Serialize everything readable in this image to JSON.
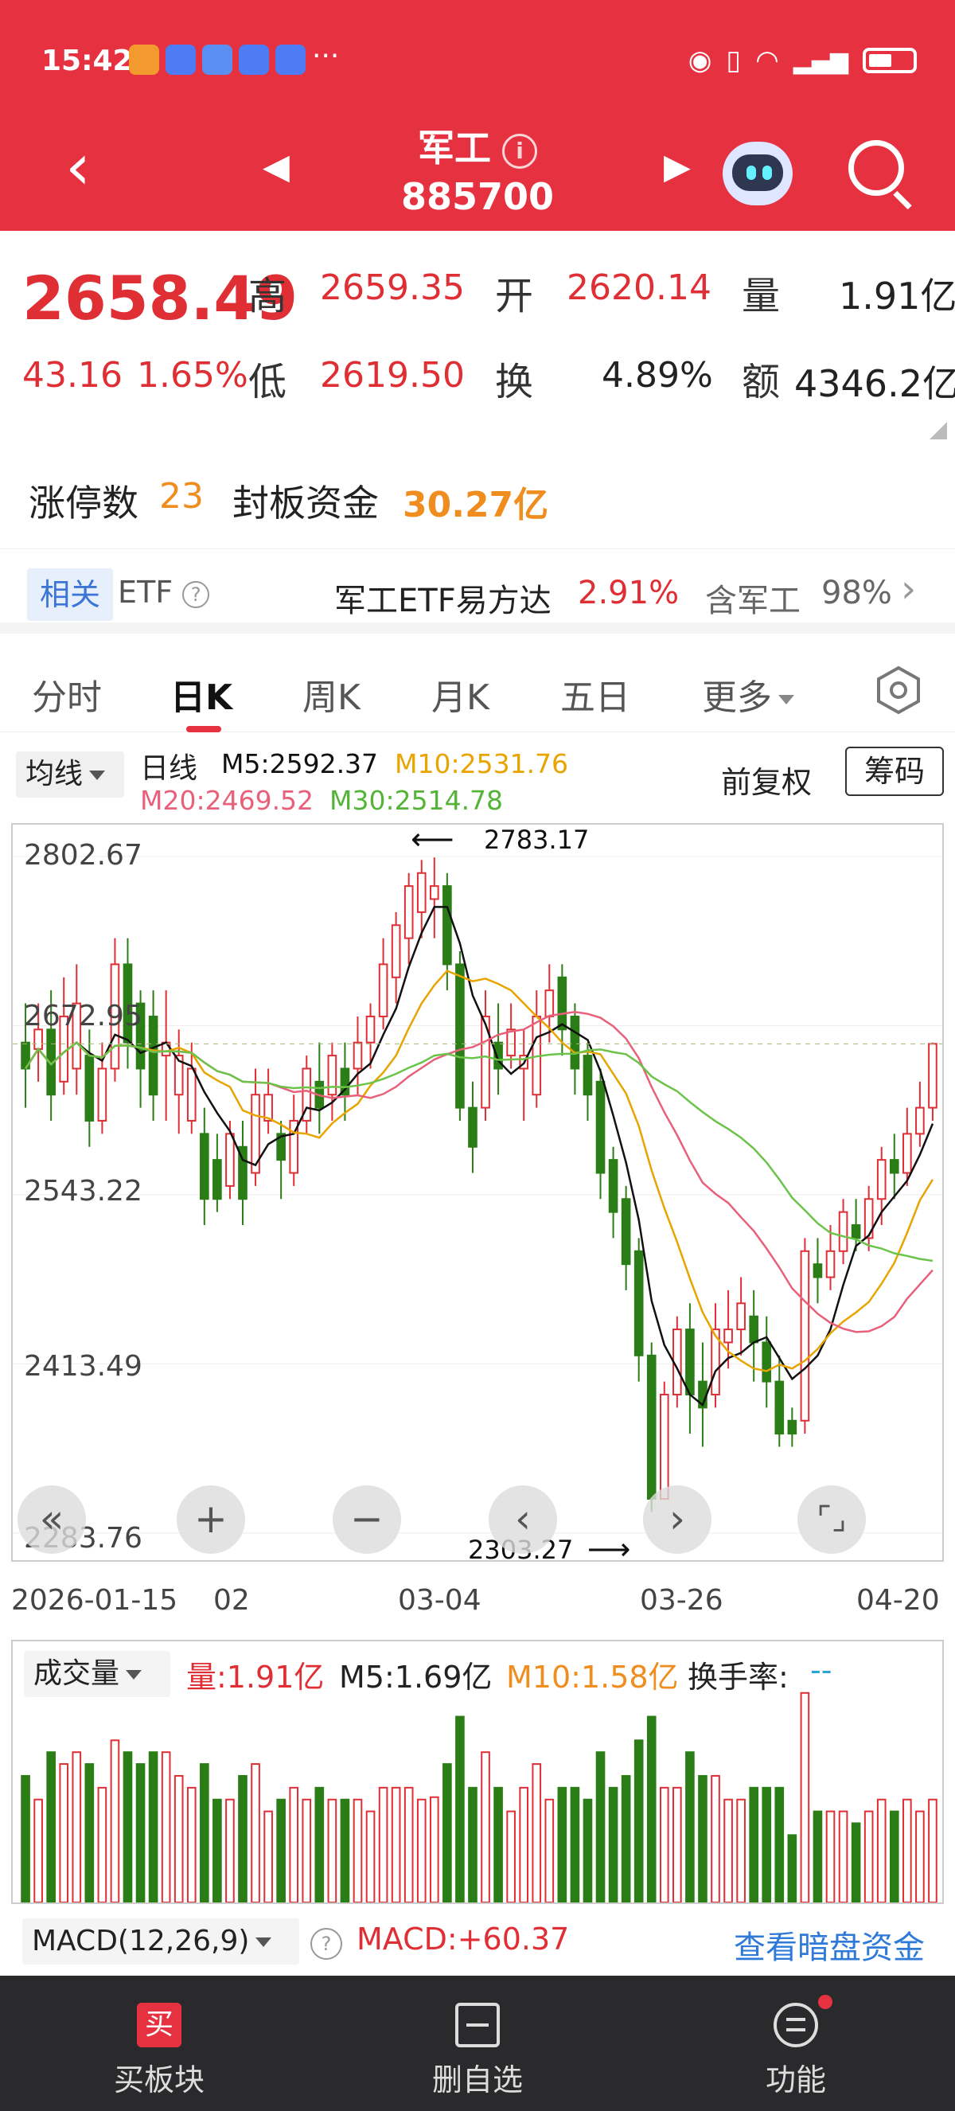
{
  "status": {
    "time": "15:42",
    "dots": "···"
  },
  "title": {
    "name": "军工",
    "info": "i",
    "code": "885700"
  },
  "quote": {
    "price": "2658.49",
    "change": "43.16",
    "change_pct": "1.65%",
    "high_label": "高",
    "high": "2659.35",
    "open_label": "开",
    "open": "2620.14",
    "vol_label": "量",
    "volume": "1.91亿",
    "low_label": "低",
    "low": "2619.50",
    "turn_label": "换",
    "turnover": "4.89%",
    "amt_label": "额",
    "amount": "4346.2亿"
  },
  "limit": {
    "count_label": "涨停数",
    "count": "23",
    "fund_label": "封板资金",
    "fund": "30.27亿"
  },
  "etf": {
    "tag": "相关",
    "label": "ETF",
    "name": "军工ETF易方达",
    "pct": "2.91%",
    "contain": "含军工",
    "contain_pct": "98%"
  },
  "tabs": [
    "分时",
    "日K",
    "周K",
    "月K",
    "五日",
    "更多"
  ],
  "legend": {
    "select": "均线",
    "type": "日线",
    "m5": "M5:2592.37",
    "m10": "M10:2531.76",
    "m20": "M20:2469.52",
    "m30": "M30:2514.78",
    "fq": "前复权",
    "chip": "筹码",
    "colors": {
      "m5": "#111111",
      "m10": "#e8a400",
      "m20": "#e8607a",
      "m30": "#6cc34a",
      "up": "#e02e35",
      "down": "#2b7d16"
    }
  },
  "chart": {
    "price_labels": [
      "2802.67",
      "2672.95",
      "2543.22",
      "2413.49",
      "2283.76"
    ],
    "hi_marker": "2783.17",
    "lo_marker": "2303.27",
    "dates": [
      "2026-01-15",
      "02",
      "03-04",
      "03-26",
      "04-20"
    ]
  },
  "chart_data": {
    "type": "candlestick",
    "ylim": [
      2283.76,
      2802.67
    ],
    "candles": [
      [
        2660,
        2640,
        2690,
        2610
      ],
      [
        2655,
        2670,
        2690,
        2630
      ],
      [
        2670,
        2620,
        2700,
        2600
      ],
      [
        2630,
        2680,
        2710,
        2620
      ],
      [
        2640,
        2690,
        2720,
        2620
      ],
      [
        2650,
        2600,
        2670,
        2580
      ],
      [
        2600,
        2640,
        2660,
        2590
      ],
      [
        2640,
        2720,
        2740,
        2630
      ],
      [
        2720,
        2660,
        2740,
        2640
      ],
      [
        2690,
        2640,
        2700,
        2610
      ],
      [
        2680,
        2620,
        2700,
        2600
      ],
      [
        2650,
        2660,
        2700,
        2600
      ],
      [
        2620,
        2650,
        2670,
        2590
      ],
      [
        2600,
        2640,
        2660,
        2590
      ],
      [
        2590,
        2540,
        2610,
        2520
      ],
      [
        2570,
        2540,
        2590,
        2530
      ],
      [
        2550,
        2590,
        2600,
        2540
      ],
      [
        2580,
        2540,
        2600,
        2520
      ],
      [
        2560,
        2620,
        2640,
        2550
      ],
      [
        2600,
        2620,
        2640,
        2590
      ],
      [
        2590,
        2570,
        2600,
        2540
      ],
      [
        2560,
        2600,
        2620,
        2550
      ],
      [
        2600,
        2640,
        2650,
        2590
      ],
      [
        2630,
        2610,
        2660,
        2590
      ],
      [
        2620,
        2650,
        2660,
        2600
      ],
      [
        2640,
        2620,
        2660,
        2600
      ],
      [
        2640,
        2660,
        2680,
        2620
      ],
      [
        2660,
        2680,
        2690,
        2640
      ],
      [
        2680,
        2720,
        2740,
        2670
      ],
      [
        2710,
        2750,
        2760,
        2690
      ],
      [
        2740,
        2780,
        2790,
        2720
      ],
      [
        2760,
        2790,
        2800,
        2740
      ],
      [
        2770,
        2780,
        2802,
        2740
      ],
      [
        2780,
        2720,
        2790,
        2700
      ],
      [
        2720,
        2610,
        2730,
        2600
      ],
      [
        2610,
        2580,
        2630,
        2560
      ],
      [
        2610,
        2680,
        2700,
        2600
      ],
      [
        2660,
        2640,
        2690,
        2620
      ],
      [
        2650,
        2670,
        2690,
        2640
      ],
      [
        2640,
        2650,
        2670,
        2600
      ],
      [
        2620,
        2680,
        2700,
        2610
      ],
      [
        2680,
        2700,
        2720,
        2660
      ],
      [
        2710,
        2670,
        2720,
        2650
      ],
      [
        2680,
        2640,
        2690,
        2620
      ],
      [
        2650,
        2620,
        2660,
        2600
      ],
      [
        2630,
        2560,
        2640,
        2540
      ],
      [
        2570,
        2530,
        2580,
        2510
      ],
      [
        2540,
        2490,
        2550,
        2470
      ],
      [
        2500,
        2420,
        2510,
        2400
      ],
      [
        2420,
        2310,
        2430,
        2300
      ],
      [
        2310,
        2390,
        2400,
        2330
      ],
      [
        2390,
        2440,
        2450,
        2380
      ],
      [
        2440,
        2390,
        2460,
        2360
      ],
      [
        2400,
        2380,
        2430,
        2350
      ],
      [
        2390,
        2440,
        2460,
        2380
      ],
      [
        2430,
        2440,
        2470,
        2410
      ],
      [
        2440,
        2460,
        2480,
        2420
      ],
      [
        2450,
        2430,
        2470,
        2400
      ],
      [
        2430,
        2400,
        2450,
        2380
      ],
      [
        2400,
        2360,
        2420,
        2350
      ],
      [
        2370,
        2360,
        2380,
        2350
      ],
      [
        2370,
        2500,
        2510,
        2360
      ],
      [
        2490,
        2480,
        2510,
        2460
      ],
      [
        2480,
        2500,
        2520,
        2470
      ],
      [
        2500,
        2530,
        2540,
        2490
      ],
      [
        2520,
        2510,
        2540,
        2500
      ],
      [
        2510,
        2540,
        2550,
        2500
      ],
      [
        2540,
        2570,
        2580,
        2520
      ],
      [
        2570,
        2560,
        2590,
        2540
      ],
      [
        2560,
        2590,
        2610,
        2550
      ],
      [
        2590,
        2610,
        2630,
        2580
      ],
      [
        2610,
        2659,
        2660,
        2600
      ]
    ]
  },
  "volume": {
    "select": "成交量",
    "vol": "量:1.91亿",
    "m5": "M5:1.69亿",
    "m10": "M10:1.58亿",
    "turn_label": "换手率:",
    "turn_val": "--"
  },
  "macd": {
    "label": "MACD(12,26,9)",
    "macd": "MACD:+60.37",
    "link": "查看暗盘资金"
  },
  "bottom": [
    "买板块",
    "删自选",
    "功能"
  ]
}
